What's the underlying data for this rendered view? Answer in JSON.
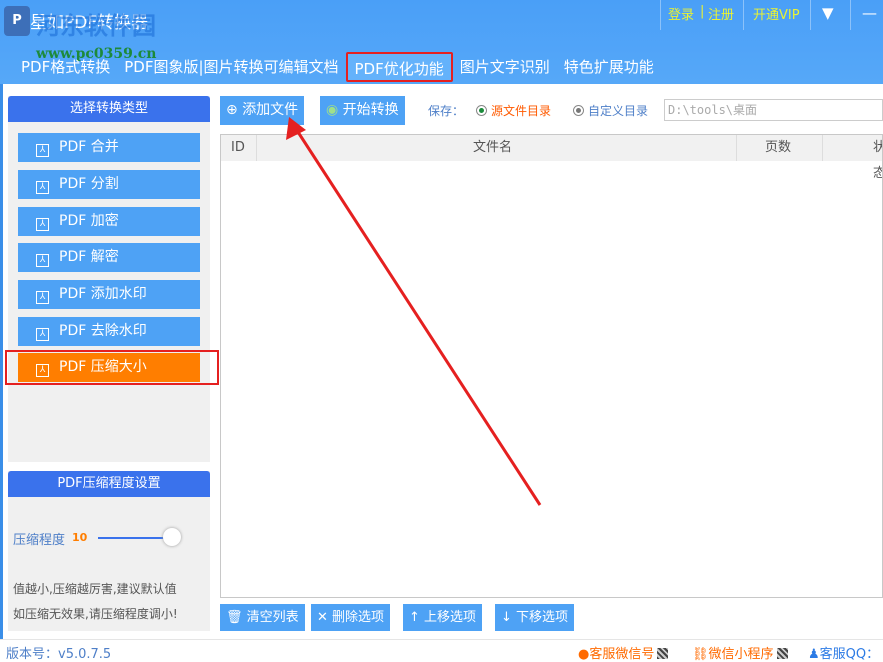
{
  "app": {
    "title": "星如PDF转换器",
    "watermark": "河东软件园",
    "watermark_url": "www.pc0359.cn",
    "logo": "P"
  },
  "topbar": {
    "login": "登录",
    "register": "注册",
    "separator": "|",
    "vip": "开通VIP",
    "menu_icon": "menu-icon",
    "minimize_icon": "minimize-icon"
  },
  "tabs": [
    "PDF格式转换",
    "PDF图象版|图片转换可编辑文档",
    "PDF优化功能",
    "图片文字识别",
    "特色扩展功能"
  ],
  "left": {
    "title": "选择转换类型",
    "items": [
      "PDF 合并",
      "PDF 分割",
      "PDF 加密",
      "PDF 解密",
      "PDF 添加水印",
      "PDF 去除水印",
      "PDF 压缩大小"
    ],
    "active_index": 6
  },
  "compress": {
    "title": "PDF压缩程度设置",
    "label": "压缩程度",
    "value": "10",
    "level_fraction": 1.0,
    "hint1": "值越小,压缩越厉害,建议默认值",
    "hint2": "如压缩无效果,请压缩程度调小!"
  },
  "toolbar": {
    "add": "添加文件",
    "start": "开始转换",
    "save_label": "保存：",
    "opt_source": "源文件目录",
    "opt_custom": "自定义目录",
    "path": "D:\\tools\\桌面"
  },
  "table": {
    "columns": [
      "ID",
      "文件名",
      "页数",
      "状态"
    ]
  },
  "bottom": {
    "clear": "清空列表",
    "delete": "删除选项",
    "up": "上移选项",
    "down": "下移选项"
  },
  "status": {
    "version": "版本号：v5.0.7.5",
    "wechat": "客服微信号",
    "miniprogram": "微信小程序",
    "qq": "客服QQ："
  },
  "colors": {
    "accent": "#4ea2f5",
    "active": "#ff7e00",
    "annotation": "#e52020"
  }
}
